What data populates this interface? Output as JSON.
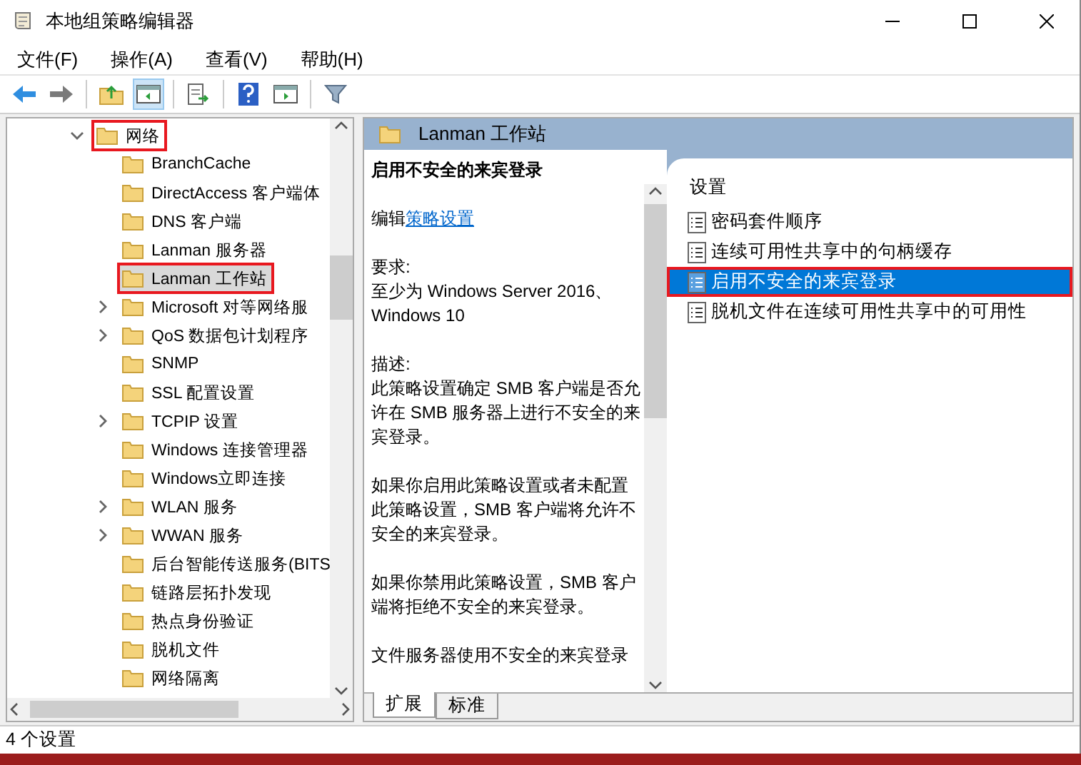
{
  "window": {
    "title": "本地组策略编辑器"
  },
  "menu": [
    "文件(F)",
    "操作(A)",
    "查看(V)",
    "帮助(H)"
  ],
  "tree": [
    {
      "label": "网络",
      "expanded": true,
      "selected": false,
      "annotated": true,
      "children": [
        {
          "label": "BranchCache",
          "expandable": false,
          "selected": false,
          "annotated": false
        },
        {
          "label": "DirectAccess 客户端体",
          "expandable": false,
          "selected": false,
          "annotated": false
        },
        {
          "label": "DNS 客户端",
          "expandable": false,
          "selected": false,
          "annotated": false
        },
        {
          "label": "Lanman 服务器",
          "expandable": false,
          "selected": false,
          "annotated": false
        },
        {
          "label": "Lanman 工作站",
          "expandable": false,
          "selected": true,
          "annotated": true
        },
        {
          "label": "Microsoft 对等网络服",
          "expandable": true,
          "selected": false,
          "annotated": false
        },
        {
          "label": "QoS 数据包计划程序",
          "expandable": true,
          "selected": false,
          "annotated": false
        },
        {
          "label": "SNMP",
          "expandable": false,
          "selected": false,
          "annotated": false
        },
        {
          "label": "SSL 配置设置",
          "expandable": false,
          "selected": false,
          "annotated": false
        },
        {
          "label": "TCPIP 设置",
          "expandable": true,
          "selected": false,
          "annotated": false
        },
        {
          "label": "Windows 连接管理器",
          "expandable": false,
          "selected": false,
          "annotated": false
        },
        {
          "label": "Windows立即连接",
          "expandable": false,
          "selected": false,
          "annotated": false
        },
        {
          "label": "WLAN 服务",
          "expandable": true,
          "selected": false,
          "annotated": false
        },
        {
          "label": "WWAN 服务",
          "expandable": true,
          "selected": false,
          "annotated": false
        },
        {
          "label": "后台智能传送服务(BITS",
          "expandable": false,
          "selected": false,
          "annotated": false
        },
        {
          "label": "链路层拓扑发现",
          "expandable": false,
          "selected": false,
          "annotated": false
        },
        {
          "label": "热点身份验证",
          "expandable": false,
          "selected": false,
          "annotated": false
        },
        {
          "label": "脱机文件",
          "expandable": false,
          "selected": false,
          "annotated": false
        },
        {
          "label": "网络隔离",
          "expandable": false,
          "selected": false,
          "annotated": false
        }
      ]
    }
  ],
  "header": {
    "title": "Lanman 工作站"
  },
  "description": {
    "title": "启用不安全的来宾登录",
    "edit_prefix": "编辑",
    "edit_link": "策略设置",
    "requirements_label": "要求:",
    "requirements": "至少为 Windows Server 2016、Windows 10",
    "description_label": "描述:",
    "paragraphs": [
      "此策略设置确定 SMB 客户端是否允许在 SMB 服务器上进行不安全的来宾登录。",
      "如果你启用此策略设置或者未配置此策略设置，SMB 客户端将允许不安全的来宾登录。",
      "如果你禁用此策略设置，SMB 客户端将拒绝不安全的来宾登录。",
      "文件服务器使用不安全的来宾登录"
    ]
  },
  "settings": {
    "column": "设置",
    "items": [
      {
        "label": "密码套件顺序",
        "selected": false,
        "annotated": false
      },
      {
        "label": "连续可用性共享中的句柄缓存",
        "selected": false,
        "annotated": false
      },
      {
        "label": "启用不安全的来宾登录",
        "selected": true,
        "annotated": true
      },
      {
        "label": "脱机文件在连续可用性共享中的可用性",
        "selected": false,
        "annotated": false
      }
    ]
  },
  "tabs": [
    {
      "label": "扩展",
      "selected": true
    },
    {
      "label": "标准",
      "selected": false
    }
  ],
  "status_bar": "4 个设置"
}
